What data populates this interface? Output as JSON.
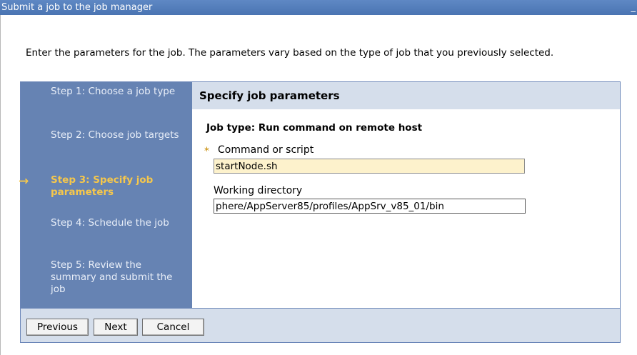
{
  "window": {
    "title": "Submit a job to the job manager",
    "minimize_glyph": "_"
  },
  "intro": "Enter the parameters for the job. The parameters vary based on the type of job that you previously selected.",
  "steps": [
    {
      "label": "Step 1: Choose a job type",
      "current": false
    },
    {
      "label": "Step 2: Choose job targets",
      "current": false
    },
    {
      "label": "Step 3: Specify job parameters",
      "current": true
    },
    {
      "label": "Step 4: Schedule the job",
      "current": false
    },
    {
      "label": "Step 5: Review the summary and submit the job",
      "current": false
    }
  ],
  "current_step_indicator": "→",
  "panel": {
    "title": "Specify job parameters",
    "job_type": "Job type: Run command on remote host",
    "required_marker": "*",
    "command": {
      "label": "Command or script",
      "value": "startNode.sh"
    },
    "working_directory": {
      "label": "Working directory",
      "value": "phere/AppServer85/profiles/AppSrv_v85_01/bin"
    }
  },
  "buttons": {
    "previous": "Previous",
    "next": "Next",
    "cancel": "Cancel"
  },
  "colors": {
    "titlebar": "#5f88c4",
    "steps_bg": "#6683b3",
    "current_step": "#f5c74c",
    "panel_header": "#d5deeb",
    "required_field": "#fdf2cc"
  }
}
